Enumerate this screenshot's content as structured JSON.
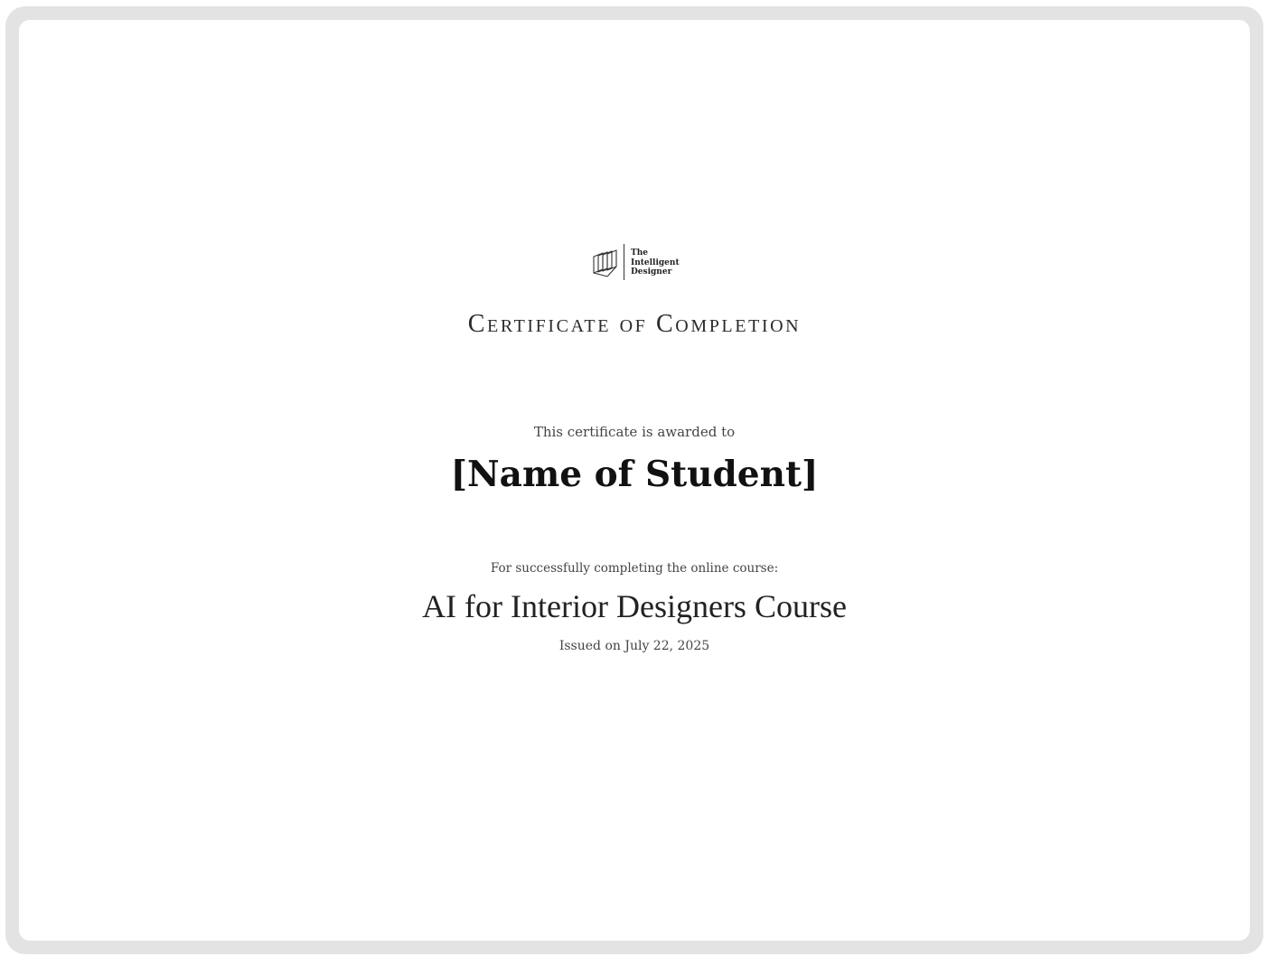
{
  "logo": {
    "name_lines": [
      "The",
      "Intelligent",
      "Designer"
    ],
    "icon": "stacked-squares-icon"
  },
  "certificate": {
    "title": "Certificate of Completion",
    "awarded_text": "This certificate is awarded to",
    "student_name": "[Name of Student]",
    "completion_text": "For successfully completing the online course:",
    "course_name": "AI for Interior Designers Course",
    "issued_text": "Issued on July 22, 2025"
  },
  "colors": {
    "frame": "#e3e3e3",
    "paper": "#ffffff",
    "text": "#222222"
  }
}
